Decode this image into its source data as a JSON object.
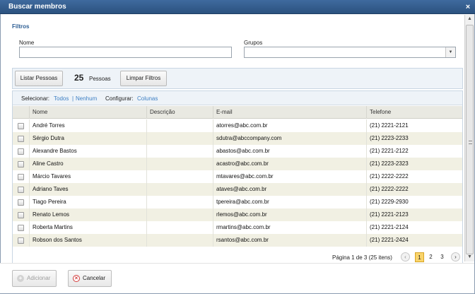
{
  "dialog": {
    "title": "Buscar membros",
    "close_glyph": "×"
  },
  "filters": {
    "section_label": "Filtros",
    "nome_label": "Nome",
    "nome_value": "",
    "grupos_label": "Grupos",
    "grupos_value": ""
  },
  "toolbar": {
    "listar_label": "Listar Pessoas",
    "count": "25",
    "count_label": "Pessoas",
    "limpar_label": "Limpar Filtros"
  },
  "selection": {
    "selecionar_label": "Selecionar:",
    "todos": "Todos",
    "separator": "|",
    "nenhum": "Nenhum",
    "configurar_label": "Configurar:",
    "colunas": "Colunas"
  },
  "table": {
    "headers": [
      "Nome",
      "Descrição",
      "E-mail",
      "Telefone"
    ],
    "rows": [
      {
        "nome": "André Torres",
        "descricao": "",
        "email": "atorres@abc.com.br",
        "telefone": "(21) 2221-2121"
      },
      {
        "nome": "Sérgio Dutra",
        "descricao": "",
        "email": "sdutra@abccompany.com",
        "telefone": "(21) 2223-2233"
      },
      {
        "nome": "Alexandre Bastos",
        "descricao": "",
        "email": "abastos@abc.com.br",
        "telefone": "(21) 2221-2122"
      },
      {
        "nome": "Aline Castro",
        "descricao": "",
        "email": "acastro@abc.com.br",
        "telefone": "(21) 2223-2323"
      },
      {
        "nome": "Márcio Tavares",
        "descricao": "",
        "email": "mtavares@abc.com.br",
        "telefone": "(21) 2222-2222"
      },
      {
        "nome": "Adriano Taves",
        "descricao": "",
        "email": "ataves@abc.com.br",
        "telefone": "(21) 2222-2222"
      },
      {
        "nome": "Tiago Pereira",
        "descricao": "",
        "email": "tpereira@abc.com.br",
        "telefone": "(21) 2229-2930"
      },
      {
        "nome": "Renato Lemos",
        "descricao": "",
        "email": "rlemos@abc.com.br",
        "telefone": "(21) 2221-2123"
      },
      {
        "nome": "Roberta Martins",
        "descricao": "",
        "email": "rmartins@abc.com.br",
        "telefone": "(21) 2221-2124"
      },
      {
        "nome": "Robson dos Santos",
        "descricao": "",
        "email": "rsantos@abc.com.br",
        "telefone": "(21) 2221-2424"
      }
    ]
  },
  "pager": {
    "info": "Página 1 de 3 (25 itens)",
    "prev_glyph": "‹",
    "next_glyph": "›",
    "pages": [
      "1",
      "2",
      "3"
    ],
    "current_page": "1"
  },
  "footer": {
    "adicionar_label": "Adicionar",
    "cancelar_label": "Cancelar"
  },
  "icons": {
    "add": "plus-circle-icon",
    "cancel": "x-circle-icon",
    "close": "close-icon",
    "dropdown": "chevron-down-icon"
  },
  "colors": {
    "titlebar": "#2c527f",
    "link": "#3d7fc4",
    "row_alt": "#f1f0e3",
    "active_page": "#f9d46b"
  }
}
